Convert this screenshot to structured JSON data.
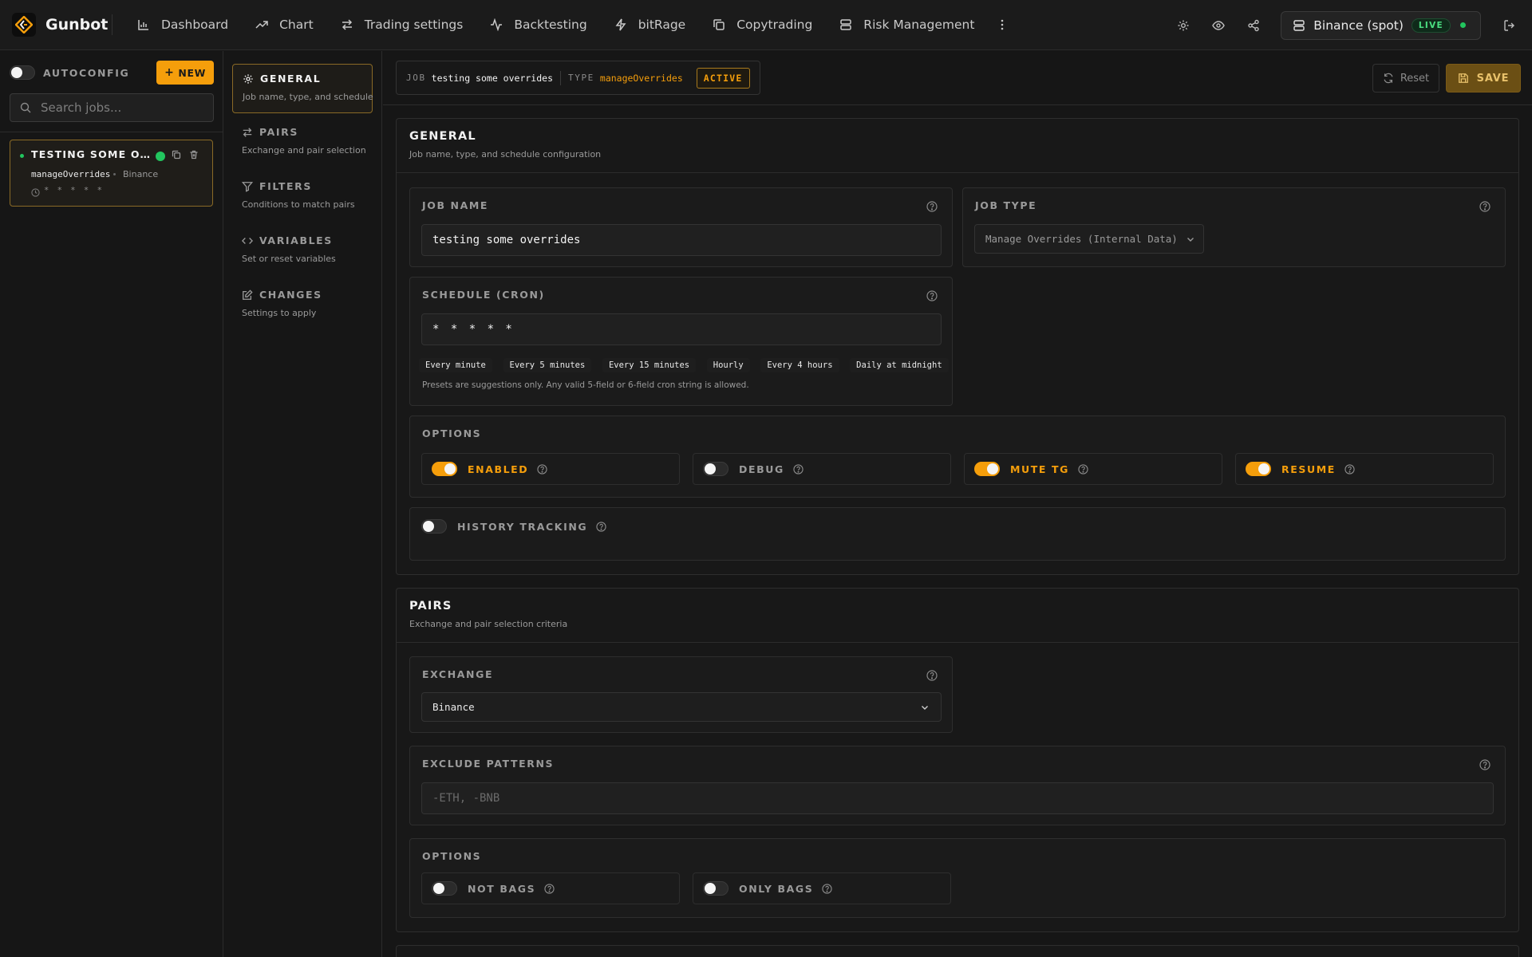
{
  "brand": {
    "name": "Gunbot"
  },
  "nav": {
    "items": [
      {
        "label": "Dashboard",
        "icon": "bar-chart-icon"
      },
      {
        "label": "Chart",
        "icon": "trend-line-icon"
      },
      {
        "label": "Trading settings",
        "icon": "swap-arrows-icon"
      },
      {
        "label": "Backtesting",
        "icon": "activity-icon"
      },
      {
        "label": "bitRage",
        "icon": "lightning-icon"
      },
      {
        "label": "Copytrading",
        "icon": "copy-icon"
      },
      {
        "label": "Risk Management",
        "icon": "server-icon"
      }
    ]
  },
  "exchange_status": {
    "label": "Binance (spot)",
    "badge": "LIVE"
  },
  "jobs_panel": {
    "autoconfig_label": "AUTOCONFIG",
    "autoconfig_on": false,
    "new_label": "NEW",
    "search_placeholder": "Search jobs...",
    "jobs": [
      {
        "title": "TESTING SOME O...",
        "type": "manageOverrides",
        "exchange": "Binance",
        "schedule": "* * * * *"
      }
    ]
  },
  "section_nav": {
    "items": [
      {
        "label": "GENERAL",
        "desc": "Job name, type, and schedule",
        "icon": "gear-icon",
        "active": true
      },
      {
        "label": "PAIRS",
        "desc": "Exchange and pair selection",
        "icon": "swap-arrows-icon",
        "active": false
      },
      {
        "label": "FILTERS",
        "desc": "Conditions to match pairs",
        "icon": "filter-icon",
        "active": false
      },
      {
        "label": "VARIABLES",
        "desc": "Set or reset variables",
        "icon": "code-icon",
        "active": false
      },
      {
        "label": "CHANGES",
        "desc": "Settings to apply",
        "icon": "edit-icon",
        "active": false
      }
    ]
  },
  "job_header": {
    "job_key": "JOB",
    "job_value": "testing some overrides",
    "type_key": "TYPE",
    "type_value": "manageOverrides",
    "status": "ACTIVE",
    "reset_label": "Reset",
    "save_label": "SAVE"
  },
  "general": {
    "title": "GENERAL",
    "subtitle": "Job name, type, and schedule configuration",
    "job_name_label": "JOB NAME",
    "job_name_value": "testing some overrides",
    "job_type_label": "JOB TYPE",
    "job_type_value": "Manage Overrides (Internal Data)",
    "schedule_label": "SCHEDULE (CRON)",
    "schedule_value": "* * * * *",
    "presets": [
      "Every minute",
      "Every 5 minutes",
      "Every 15 minutes",
      "Hourly",
      "Every 4 hours",
      "Daily at midnight"
    ],
    "presets_hint": "Presets are suggestions only. Any valid 5-field or 6-field cron string is allowed.",
    "options_label": "OPTIONS",
    "options": [
      {
        "label": "ENABLED",
        "on": true
      },
      {
        "label": "DEBUG",
        "on": false
      },
      {
        "label": "MUTE TG",
        "on": true
      },
      {
        "label": "RESUME",
        "on": true
      }
    ],
    "history_label": "HISTORY TRACKING",
    "history_on": false
  },
  "pairs": {
    "title": "PAIRS",
    "subtitle": "Exchange and pair selection criteria",
    "exchange_label": "EXCHANGE",
    "exchange_value": "Binance",
    "exclude_label": "EXCLUDE PATTERNS",
    "exclude_placeholder": "-ETH, -BNB",
    "options_label": "OPTIONS",
    "options": [
      {
        "label": "NOT BAGS",
        "on": false
      },
      {
        "label": "ONLY BAGS",
        "on": false
      }
    ]
  },
  "colors": {
    "accent": "#f59e0b",
    "live": "#22c55e",
    "background": "#161616"
  }
}
